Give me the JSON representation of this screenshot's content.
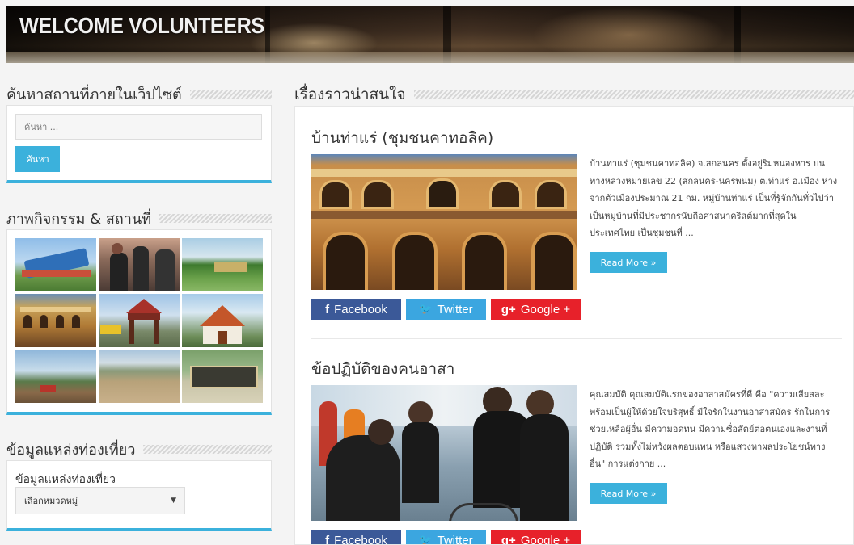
{
  "header": {
    "title": "WELCOME VOLUNTEERS"
  },
  "sidebar": {
    "search_widget": {
      "title": "ค้นหาสถานที่ภายในเว็ปไซต์",
      "placeholder": "ค้นหา ...",
      "button_label": "ค้นหา"
    },
    "gallery_widget": {
      "title": "ภาพกิจกรรม & สถานที่",
      "images": [
        "village-sign",
        "volunteers-group",
        "riverside-field",
        "colonial-building",
        "gate-arch",
        "thai-temple",
        "lake-view",
        "dry-landscape",
        "welcome-sign"
      ]
    },
    "tourism_widget": {
      "title": "ข้อมูลแหล่งท่องเที่ยว",
      "label": "ข้อมูลแหล่งท่องเที่ยว",
      "select_value": "เลือกหมวดหมู่"
    }
  },
  "main": {
    "section_title": "เรื่องราวน่าสนใจ",
    "posts": [
      {
        "title": "บ้านท่าแร่ (ชุมชนคาทอลิค)",
        "excerpt": "บ้านท่าแร่ (ชุมชนคาทอลิค) จ.สกลนคร ตั้งอยู่ริมหนองหาร บนทางหลวงหมายเลข 22 (สกลนคร-นครพนม) ต.ท่าแร่ อ.เมือง ห่างจากตัวเมืองประมาณ 21 กม. หมู่บ้านท่าแร่ เป็นที่รู้จักกันทั่วไปว่าเป็นหมู่บ้านที่มีประชากรนับถือศาสนาคริสต์มากที่สุดในประเทศไทย เป็นชุมชนที่ ...",
        "read_more": "Read More »"
      },
      {
        "title": "ข้อปฏิบัติของคนอาสา",
        "excerpt": "คุณสมบัติ คุณสมบัติแรกของอาสาสมัครที่ดี คือ \"ความเสียสละ พร้อมเป็นผู้ให้ด้วยใจบริสุทธิ์ มีใจรักในงานอาสาสมัคร รักในการช่วยเหลือผู้อื่น มีความอดทน มีความซื่อสัตย์ต่อตนเองและงานที่ปฏิบัติ รวมทั้งไม่หวังผลตอบแทน หรือแสวงหาผลประโยชน์ทางอื่น\" การแต่งกาย ...",
        "read_more": "Read More »"
      }
    ],
    "share": {
      "facebook": "Facebook",
      "twitter": "Twitter",
      "google": "Google +"
    }
  },
  "colors": {
    "accent": "#3bb1dc",
    "facebook": "#3b5998",
    "twitter": "#3ba6e0",
    "google": "#e7212a"
  }
}
